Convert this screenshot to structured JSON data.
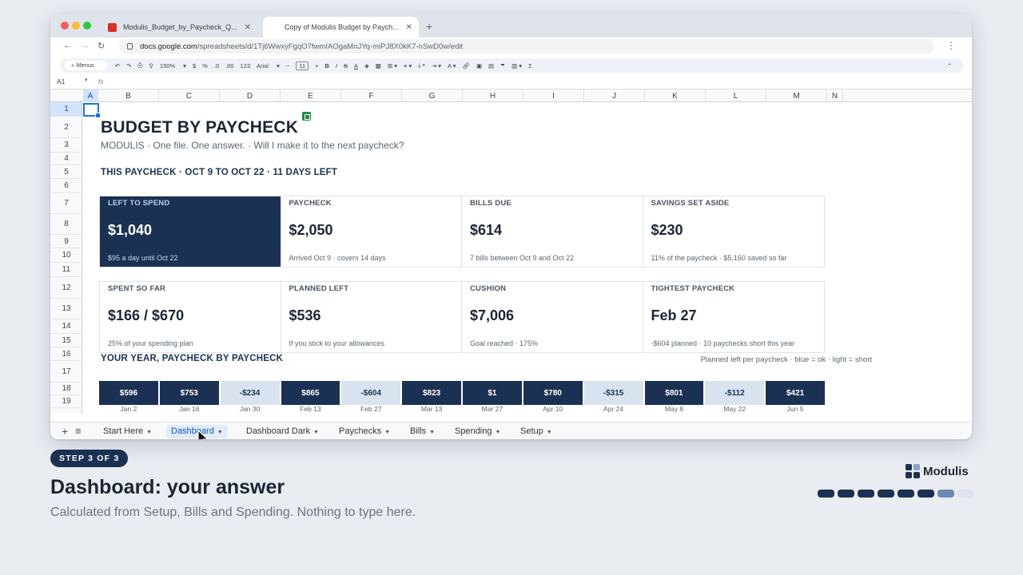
{
  "browser": {
    "tabs": [
      {
        "title": "Modulis_Budget_by_Paycheck_Q...",
        "icon": "pdf-icon"
      },
      {
        "title": "Copy of Modulis Budget by Paych...",
        "icon": "sheets-icon"
      }
    ],
    "url_host": "docs.google.com",
    "url_path": "/spreadsheets/d/1Tj6WwxyFgqO7fwmIAOgaMnJYq-miPJ8X0kK7-nSwD0w/edit"
  },
  "toolbar": {
    "menus": "Menus",
    "zoom": "150%",
    "currency": "$",
    "percent": "%",
    "dec_less": ".0",
    "dec_more": ".00",
    "number_fmt": "123",
    "font": "Arial",
    "font_size": "11"
  },
  "formula_bar": {
    "cell_ref": "A1",
    "fx": "fx"
  },
  "grid": {
    "columns": [
      "A",
      "B",
      "C",
      "D",
      "E",
      "F",
      "G",
      "H",
      "I",
      "J",
      "K",
      "L",
      "M",
      "N"
    ],
    "rows": [
      "1",
      "2",
      "3",
      "4",
      "5",
      "6",
      "7",
      "8",
      "9",
      "10",
      "11",
      "12",
      "13",
      "14",
      "15",
      "16",
      "17",
      "18",
      "19"
    ]
  },
  "sheet": {
    "title": "BUDGET BY PAYCHECK",
    "subtitle": "MODULIS · One file. One answer. · Will I make it to the next paycheck?",
    "section1": "THIS PAYCHECK · OCT 9 TO OCT 22 · 11 DAYS LEFT",
    "cards_row1": [
      {
        "label": "LEFT TO SPEND",
        "value": "$1,040",
        "sub": "$95 a day until Oct 22"
      },
      {
        "label": "PAYCHECK",
        "value": "$2,050",
        "sub": "Arrived Oct 9 · covers 14 days"
      },
      {
        "label": "BILLS DUE",
        "value": "$614",
        "sub": "7 bills between Oct 9 and Oct 22"
      },
      {
        "label": "SAVINGS SET ASIDE",
        "value": "$230",
        "sub": "11% of the paycheck · $5,160 saved so far"
      }
    ],
    "cards_row2": [
      {
        "label": "SPENT SO FAR",
        "value": "$166 / $670",
        "sub": "25% of your spending plan"
      },
      {
        "label": "PLANNED LEFT",
        "value": "$536",
        "sub": "If you stick to your allowances"
      },
      {
        "label": "CUSHION",
        "value": "$7,006",
        "sub": "Goal reached · 175%"
      },
      {
        "label": "TIGHTEST PAYCHECK",
        "value": "Feb 27",
        "sub": "-$604 planned · 10 paychecks short this year"
      }
    ],
    "section2": "YOUR YEAR, PAYCHECK BY PAYCHECK",
    "legend": "Planned left per paycheck · blue = ok · light = short",
    "paychecks": [
      {
        "value": "$596",
        "date": "Jan 2",
        "status": "ok"
      },
      {
        "value": "$753",
        "date": "Jan 16",
        "status": "ok"
      },
      {
        "value": "-$234",
        "date": "Jan 30",
        "status": "short"
      },
      {
        "value": "$865",
        "date": "Feb 13",
        "status": "ok"
      },
      {
        "value": "-$604",
        "date": "Feb 27",
        "status": "short"
      },
      {
        "value": "$823",
        "date": "Mar 13",
        "status": "ok"
      },
      {
        "value": "$1",
        "date": "Mar 27",
        "status": "ok"
      },
      {
        "value": "$780",
        "date": "Apr 10",
        "status": "ok"
      },
      {
        "value": "-$315",
        "date": "Apr 24",
        "status": "short"
      },
      {
        "value": "$801",
        "date": "May 8",
        "status": "ok"
      },
      {
        "value": "-$112",
        "date": "May 22",
        "status": "short"
      },
      {
        "value": "$421",
        "date": "Jun 5",
        "status": "ok"
      }
    ],
    "row19_status": [
      "ok",
      "ok",
      "ok",
      "short",
      "ok",
      "short",
      "ok",
      "short",
      "ok",
      "short",
      "ok",
      "short"
    ]
  },
  "sheet_tabs": [
    "Start Here",
    "Dashboard",
    "Dashboard Dark",
    "Paychecks",
    "Bills",
    "Spending",
    "Setup"
  ],
  "active_sheet_tab": "Dashboard",
  "caption": {
    "step": "STEP 3 OF 3",
    "title": "Dashboard: your answer",
    "subtitle": "Calculated from Setup, Bills and Spending. Nothing to type here.",
    "brand": "Modulis",
    "progress_total": 8,
    "progress_current": 7
  },
  "colors": {
    "navy": "#1b3153",
    "light": "#d9e3ef",
    "selection": "#1a73e8"
  }
}
